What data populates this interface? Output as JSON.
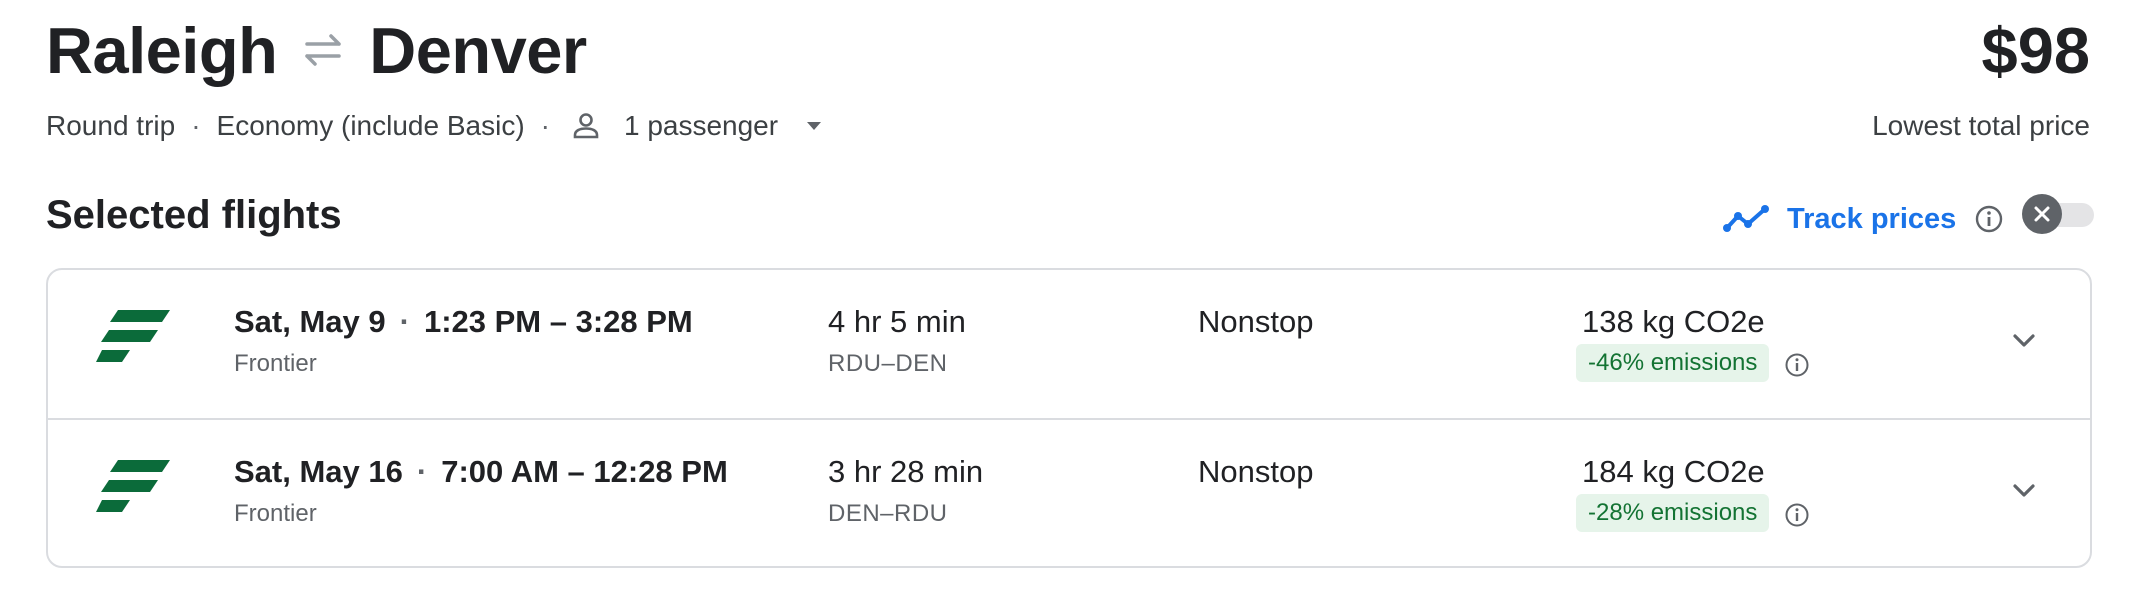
{
  "header": {
    "origin": "Raleigh",
    "destination": "Denver",
    "price": "$98",
    "price_caption": "Lowest total price"
  },
  "trip": {
    "type": "Round trip",
    "cabin": "Economy (include Basic)",
    "passengers": "1 passenger",
    "separator": "·"
  },
  "section": {
    "title": "Selected flights",
    "track_label": "Track prices",
    "track_enabled": false
  },
  "flights": [
    {
      "date": "Sat, May 9",
      "time": "1:23 PM – 3:28 PM",
      "airline": "Frontier",
      "duration": "4 hr 5 min",
      "route": "RDU–DEN",
      "stops": "Nonstop",
      "co2": "138 kg CO2e",
      "emissions": "-46% emissions"
    },
    {
      "date": "Sat, May 16",
      "time": "7:00 AM – 12:28 PM",
      "airline": "Frontier",
      "duration": "3 hr 28 min",
      "route": "DEN–RDU",
      "stops": "Nonstop",
      "co2": "184 kg CO2e",
      "emissions": "-28% emissions"
    }
  ],
  "colors": {
    "accent": "#1a73e8",
    "frontier_green": "#0b6b3a",
    "emission_bg": "#e6f4ea",
    "emission_text": "#137333"
  }
}
